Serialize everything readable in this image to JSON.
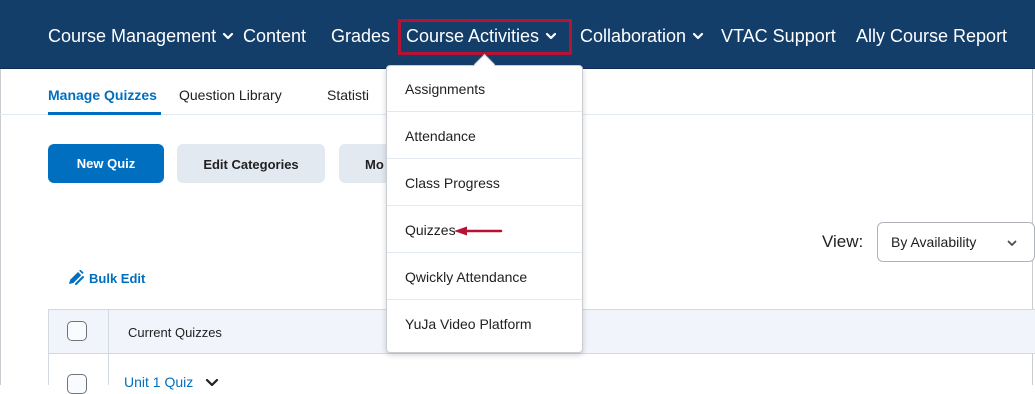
{
  "nav": {
    "items": [
      {
        "label": "Course Management",
        "dropdown": true
      },
      {
        "label": "Content",
        "dropdown": false
      },
      {
        "label": "Grades",
        "dropdown": false
      },
      {
        "label": "Course Activities",
        "dropdown": true
      },
      {
        "label": "Collaboration",
        "dropdown": true
      },
      {
        "label": "VTAC Support",
        "dropdown": false
      },
      {
        "label": "Ally Course Report",
        "dropdown": false
      }
    ],
    "highlight_color": "#b71234",
    "background": "#143e6a"
  },
  "subtabs": {
    "items": [
      "Manage Quizzes",
      "Question Library",
      "Statisti"
    ],
    "active": "Manage Quizzes"
  },
  "toolbar": {
    "new_quiz": "New Quiz",
    "edit_categories": "Edit Categories",
    "more_partial": "Mo"
  },
  "view": {
    "label": "View:",
    "selected": "By Availability"
  },
  "bulk_edit": {
    "label": "Bulk Edit",
    "icon": "pencil-icon"
  },
  "table": {
    "header": "Current Quizzes",
    "rows": [
      {
        "name": "Unit 1 Quiz"
      }
    ]
  },
  "dropdown_menu": {
    "items": [
      "Assignments",
      "Attendance",
      "Class Progress",
      "Quizzes",
      "Qwickly Attendance",
      "YuJa Video Platform"
    ],
    "pointer_item": "Quizzes",
    "pointer_color": "#b71234"
  },
  "colors": {
    "accent": "#006fbf"
  }
}
